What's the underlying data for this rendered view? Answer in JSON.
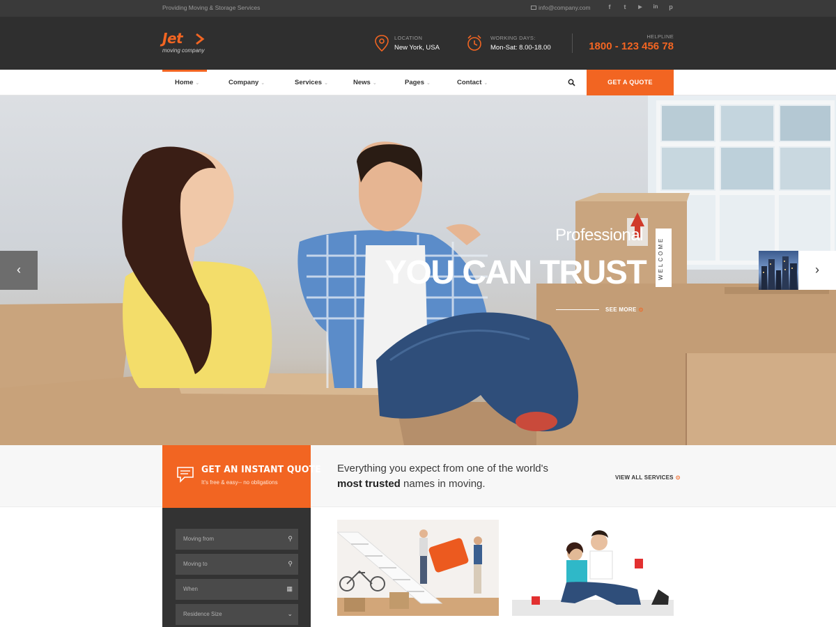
{
  "topbar": {
    "tagline": "Providing Moving & Storage Services",
    "email": "info@company.com",
    "socials": [
      "facebook-icon",
      "twitter-icon",
      "youtube-icon",
      "linkedin-icon",
      "pinterest-icon"
    ],
    "social_glyphs": [
      "f",
      "t",
      "▶",
      "in",
      "p"
    ]
  },
  "header": {
    "logo_word": "Jet",
    "logo_sub": "moving company",
    "location_label": "LOCATION",
    "location_value": "New York, USA",
    "hours_label": "WORKING DAYS:",
    "hours_value": "Mon-Sat: 8.00-18.00",
    "helpline_label": "HELPLINE",
    "helpline_value": "1800 - 123 456 78"
  },
  "nav": {
    "items": [
      "Home",
      "Company",
      "Services",
      "News",
      "Pages",
      "Contact"
    ],
    "active": "Home",
    "cta": "GET A QUOTE"
  },
  "hero": {
    "eyebrow": "Professional",
    "title": "YOU CAN TRUST",
    "vertical_tag": "WELCOME",
    "see_more": "SEE MORE",
    "prev": "‹",
    "next": "›"
  },
  "quote_panel": {
    "title": "GET AN INSTANT QUOTE",
    "subtitle": "It's free & easy-- no obligations",
    "fields": [
      {
        "placeholder": "Moving from",
        "icon": "map-pin-icon",
        "glyph": "⚲"
      },
      {
        "placeholder": "Moving to",
        "icon": "map-pin-icon",
        "glyph": "⚲"
      },
      {
        "placeholder": "When",
        "icon": "calendar-icon",
        "glyph": "▦"
      },
      {
        "placeholder": "Residence Size",
        "icon": "chevron-down-icon",
        "glyph": "⌄"
      }
    ]
  },
  "services_intro": {
    "line1": "Everything you expect from one of the world's",
    "line2_bold": "most trusted",
    "line2_rest": " names in moving.",
    "view_all": "VIEW ALL SERVICES"
  },
  "colors": {
    "accent": "#f26522",
    "dark": "#2f2f2f",
    "topbar": "#3a3a3a",
    "panel": "#333333"
  }
}
